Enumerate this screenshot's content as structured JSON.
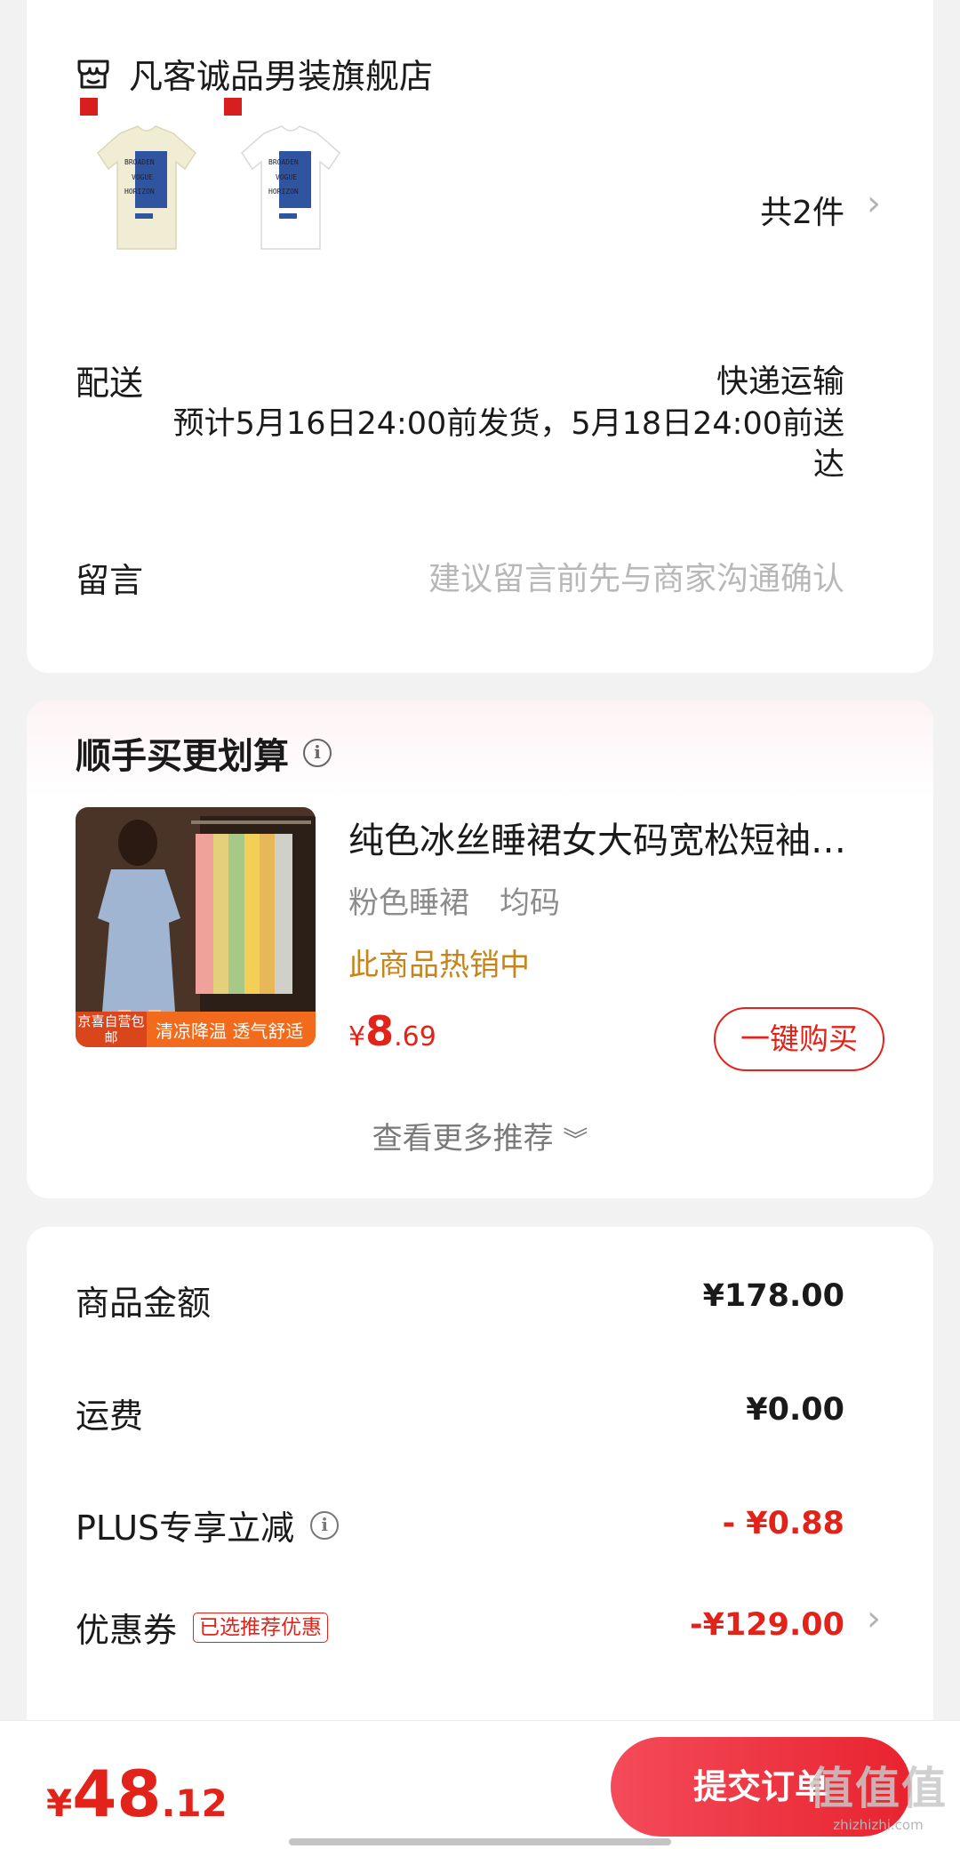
{
  "shop": {
    "name": "凡客诚品男装旗舰店",
    "total_count": "共2件",
    "products": [
      {
        "name": "cream-tshirt",
        "color": "#f1ecd4"
      },
      {
        "name": "white-tshirt",
        "color": "#ffffff"
      }
    ],
    "print_text": [
      "BROADEN",
      "VOGUE",
      "HORIZON"
    ],
    "brand_tag": "凡客诚品"
  },
  "delivery": {
    "label": "配送",
    "method": "快递运输",
    "note": "预计5月16日24:00前发货，5月18日24:00前送达"
  },
  "message": {
    "label": "留言",
    "placeholder": "建议留言前先与商家沟通确认"
  },
  "recommend": {
    "title": "顺手买更划算",
    "product_name": "纯色冰丝睡裙女大码宽松短袖…",
    "spec": "粉色睡裙　均码",
    "hot": "此商品热销中",
    "price": {
      "symbol": "¥",
      "integer": "8",
      "decimal": ".69"
    },
    "buy_label": "一键购买",
    "see_more": "查看更多推荐",
    "badge_left": "京喜自营包邮",
    "badge_right": "清凉降温 透气舒适"
  },
  "summary": {
    "items": [
      {
        "label": "商品金额",
        "value": "¥178.00"
      },
      {
        "label": "运费",
        "value": "¥0.00"
      },
      {
        "label": "PLUS专享立减",
        "value": "- ¥0.88"
      },
      {
        "label": "优惠券",
        "value": "-¥129.00",
        "tag": "已选推荐优惠"
      }
    ]
  },
  "bottom": {
    "total": {
      "symbol": "¥",
      "integer": "48",
      "decimal": ".12"
    },
    "submit_label": "提交订单"
  },
  "watermark": {
    "main": "值值值",
    "sub": "zhizhizhi.com"
  },
  "colors": {
    "accent": "#e2231a",
    "hot": "#c6841a",
    "background": "#f2f2f2"
  }
}
